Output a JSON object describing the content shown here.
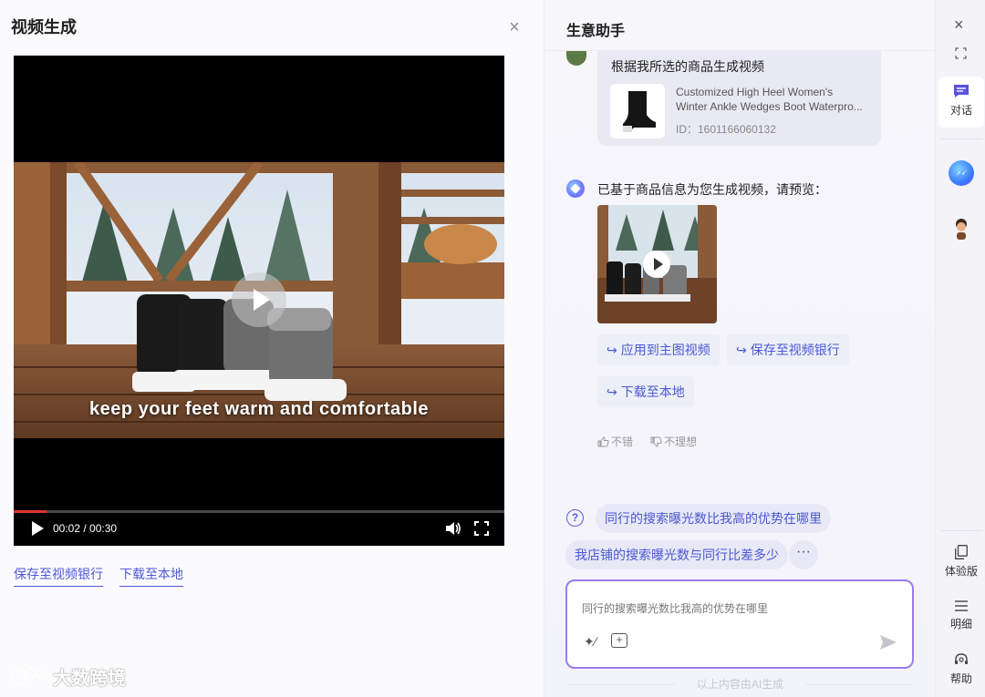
{
  "left_panel": {
    "title": "视频生成",
    "close_icon": "close-icon",
    "video": {
      "caption": "keep your feet warm and comfortable",
      "time": "00:02 / 00:30",
      "progress": 0.067
    },
    "links": {
      "save_to_bank": "保存至视频银行",
      "download_local": "下载至本地"
    },
    "watermark": "大数跨境"
  },
  "chat": {
    "title": "生意助手",
    "user_message": "根据我所选的商品生成视频",
    "product": {
      "name_line1": "Customized High Heel Women's",
      "name_line2": "Winter Ankle Wedges Boot Waterpro...",
      "id": "ID：1601166060132"
    },
    "ai_message": "已基于商品信息为您生成视频，请预览：",
    "actions": {
      "apply_main": "应用到主图视频",
      "save_bank": "保存至视频银行",
      "download": "下载至本地"
    },
    "feedback": {
      "good": "不错",
      "bad": "不理想"
    },
    "suggestions": [
      "同行的搜索曝光数比我高的优势在哪里",
      "我店铺的搜索曝光数与同行比差多少"
    ],
    "more_label": "···",
    "input": {
      "value": "同行的搜索曝光数比我高的优势在哪里"
    },
    "footnote": "以上内容由AI生成"
  },
  "sidebar": {
    "items": {
      "dialog": "对话",
      "trial": "体验版",
      "detail": "明细",
      "help": "帮助"
    }
  },
  "colors": {
    "accent": "#4a57d4",
    "input_border": "#9b7bf0",
    "progress": "#e0362b"
  }
}
